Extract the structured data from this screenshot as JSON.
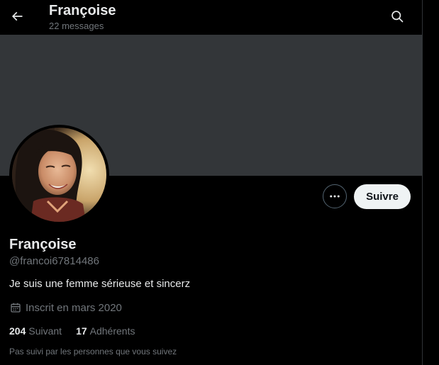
{
  "header": {
    "title": "Françoise",
    "subtitle": "22 messages",
    "back_icon": "arrow-left-icon",
    "search_icon": "search-icon"
  },
  "banner": {
    "color": "#333639"
  },
  "profile": {
    "avatar_icon": "profile-photo",
    "more_icon": "more-horizontal-icon",
    "follow_label": "Suivre",
    "display_name": "Françoise",
    "handle": "@francoi67814486",
    "bio": "Je suis une femme sérieuse et sincerz",
    "joined_icon": "calendar-icon",
    "joined": "Inscrit en mars 2020",
    "following_count": "204",
    "following_label": "Suivant",
    "followers_count": "17",
    "followers_label": "Adhérents",
    "not_followed_note": "Pas suivi par les personnes que vous suivez"
  },
  "colors": {
    "background": "#000000",
    "text_primary": "#e7e9ea",
    "text_secondary": "#71767b",
    "follow_button_bg": "#eff3f4"
  }
}
